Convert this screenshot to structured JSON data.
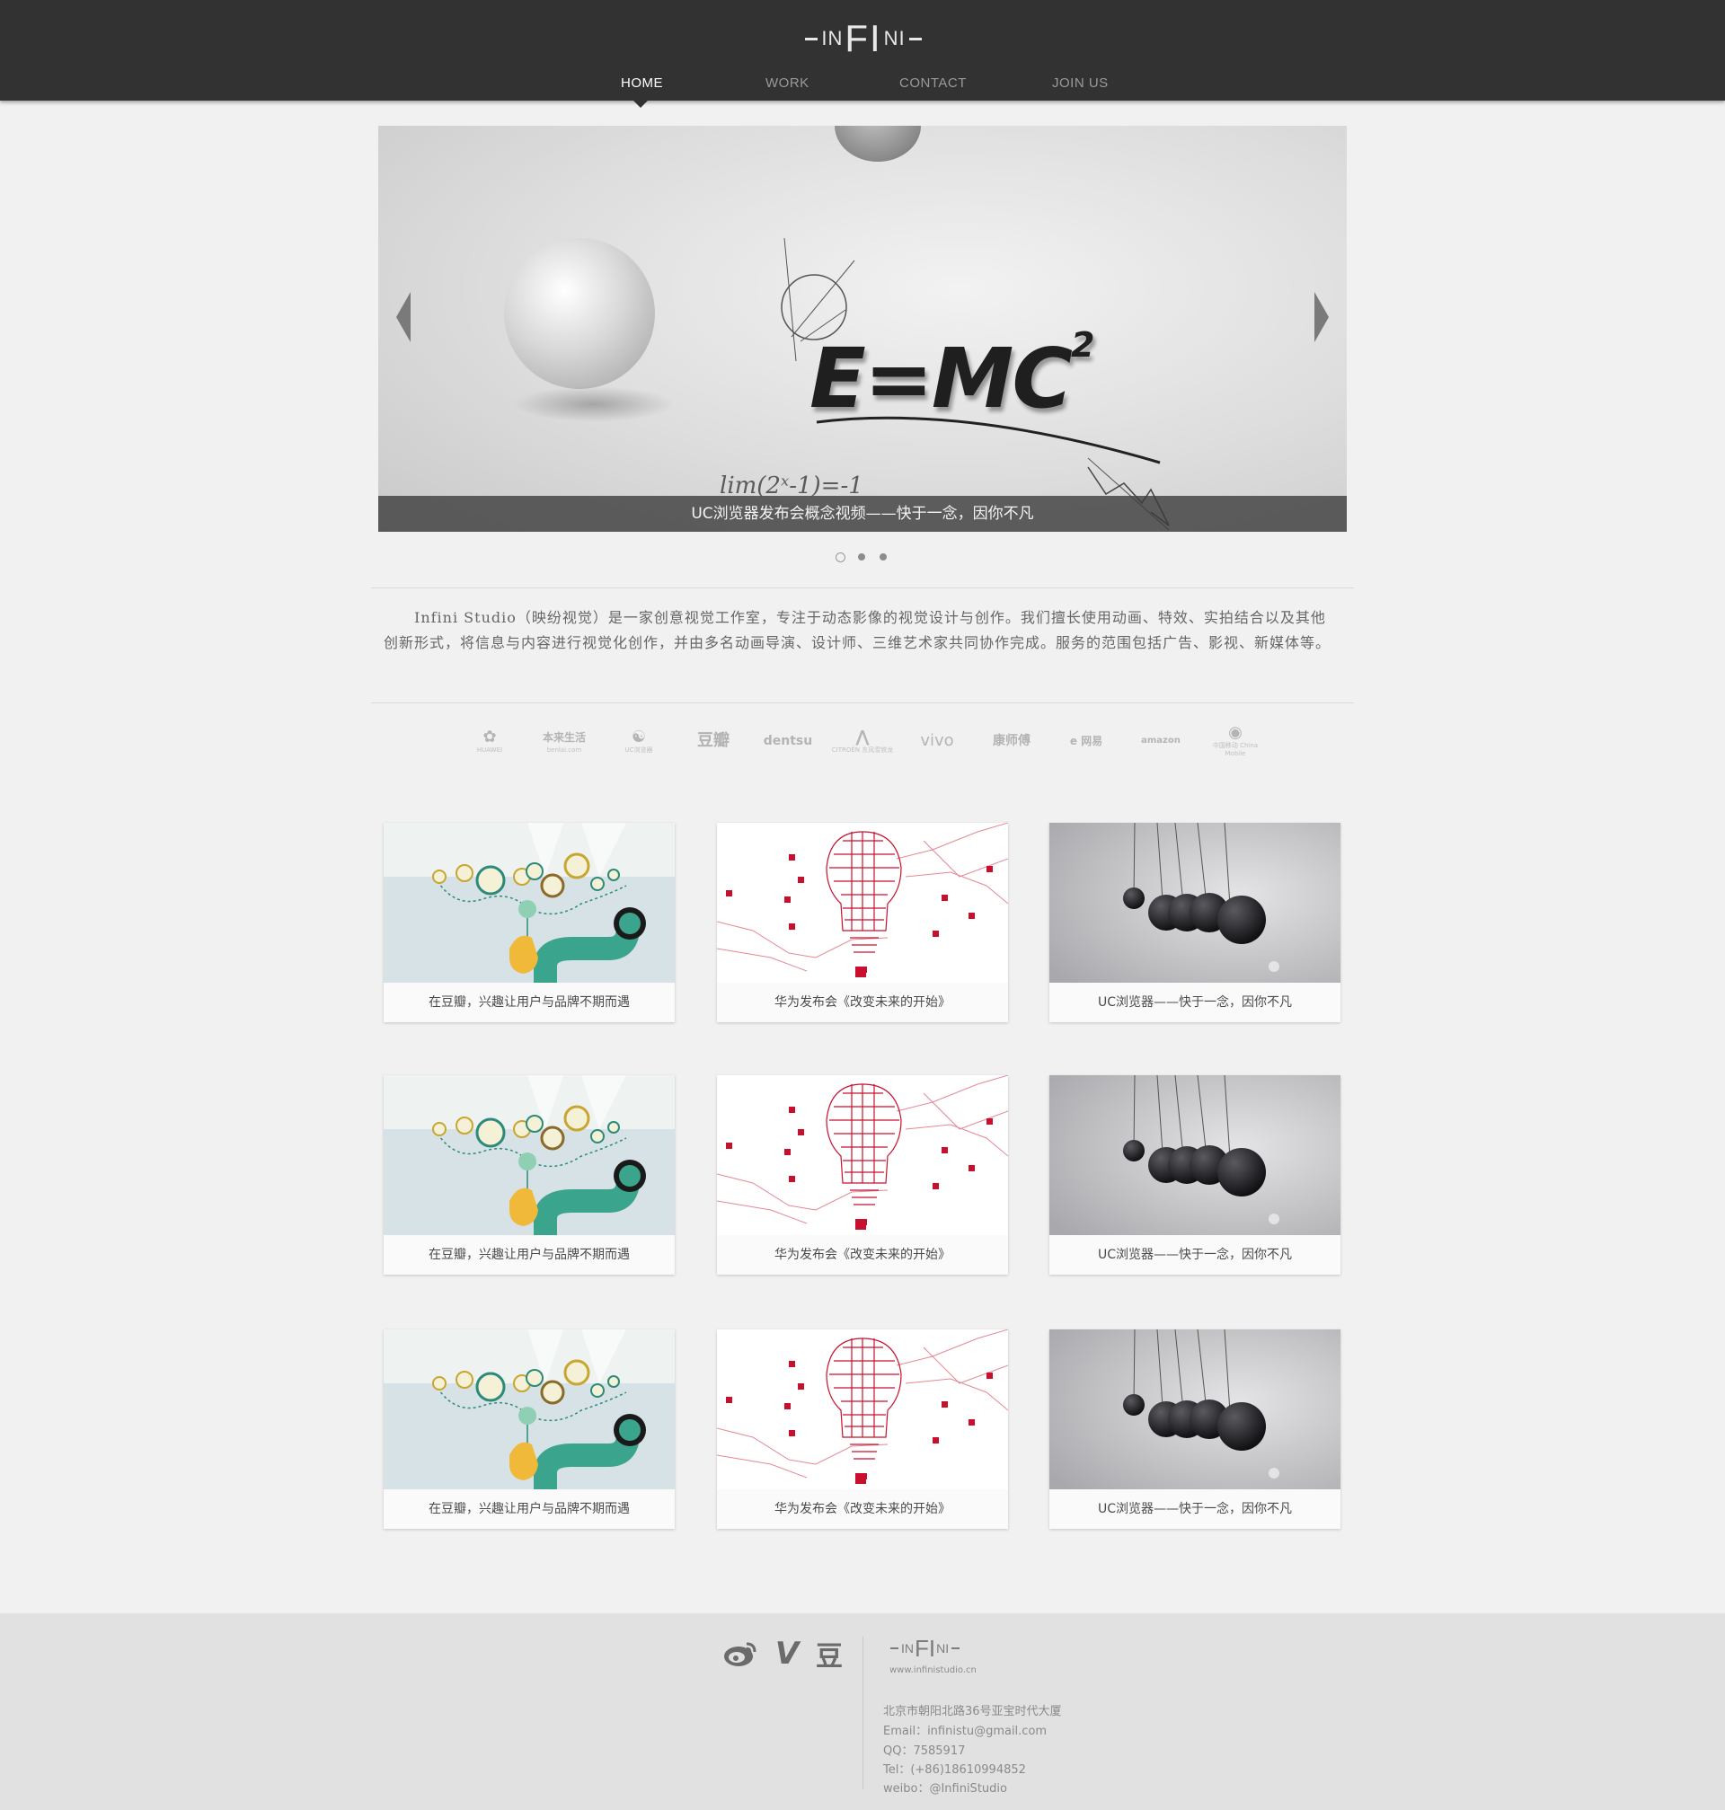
{
  "header": {
    "logo": {
      "left": "IN",
      "center": "FI",
      "right": "NI"
    },
    "nav": [
      {
        "label": "HOME",
        "active": true
      },
      {
        "label": "WORK",
        "active": false
      },
      {
        "label": "CONTACT",
        "active": false
      },
      {
        "label": "JOIN US",
        "active": false
      }
    ]
  },
  "banner": {
    "formula_main": "E=MC",
    "formula_exp": "2",
    "formula_small": "lim(2ˣ-1)=-1",
    "caption": "UC浏览器发布会概念视频——快于一念，因你不凡",
    "slides": 3,
    "active_slide": 1
  },
  "intro": {
    "text": "Infini Studio（映纷视觉）是一家创意视觉工作室，专注于动态影像的视觉设计与创作。我们擅长使用动画、特效、实拍结合以及其他创新形式，将信息与内容进行视觉化创作，并由多名动画导演、设计师、三维艺术家共同协作完成。服务的范围包括广告、影视、新媒体等。"
  },
  "clients": [
    {
      "mark": "✿",
      "sub": "HUAWEI"
    },
    {
      "mark": "本来生活",
      "sub": "benlai.com"
    },
    {
      "mark": "☯",
      "sub": "UC浏览器"
    },
    {
      "mark": "豆瓣",
      "sub": ""
    },
    {
      "mark": "dentsu",
      "sub": ""
    },
    {
      "mark": "⋀",
      "sub": "CITROËN 东风雪铁龙"
    },
    {
      "mark": "vivo",
      "sub": ""
    },
    {
      "mark": "康师傅",
      "sub": ""
    },
    {
      "mark": "e 网易",
      "sub": ""
    },
    {
      "mark": "amazon",
      "sub": ""
    },
    {
      "mark": "◉",
      "sub": "中国移动 China Mobile"
    }
  ],
  "works": [
    {
      "type": "douban",
      "title": "在豆瓣，兴趣让用户与品牌不期而遇"
    },
    {
      "type": "huawei",
      "title": "华为发布会《改变未来的开始》"
    },
    {
      "type": "uc",
      "title": "UC浏览器——快于一念，因你不凡"
    },
    {
      "type": "douban",
      "title": "在豆瓣，兴趣让用户与品牌不期而遇"
    },
    {
      "type": "huawei",
      "title": "华为发布会《改变未来的开始》"
    },
    {
      "type": "uc",
      "title": "UC浏览器——快于一念，因你不凡"
    },
    {
      "type": "douban",
      "title": "在豆瓣，兴趣让用户与品牌不期而遇"
    },
    {
      "type": "huawei",
      "title": "华为发布会《改变未来的开始》"
    },
    {
      "type": "uc",
      "title": "UC浏览器——快于一念，因你不凡"
    }
  ],
  "footer": {
    "social": [
      {
        "name": "weibo-icon",
        "glyph": "ⓦ"
      },
      {
        "name": "vimeo-icon",
        "glyph": "V"
      },
      {
        "name": "douban-icon",
        "glyph": "豆"
      }
    ],
    "logo": {
      "left": "IN",
      "center": "FI",
      "right": "NI"
    },
    "url": "www.infinistudio.cn",
    "address": "北京市朝阳北路36号亚宝时代大厦",
    "email": "Email：infinistu@gmail.com",
    "qq": "QQ：7585917",
    "tel": "Tel：(+86)18610994852",
    "weibo": "weibo：@InfiniStudio"
  },
  "colors": {
    "header_bg": "#323232",
    "page_bg": "#f1f1f1",
    "footer_bg": "#e1e1e1",
    "accent_red": "#c8102e"
  }
}
